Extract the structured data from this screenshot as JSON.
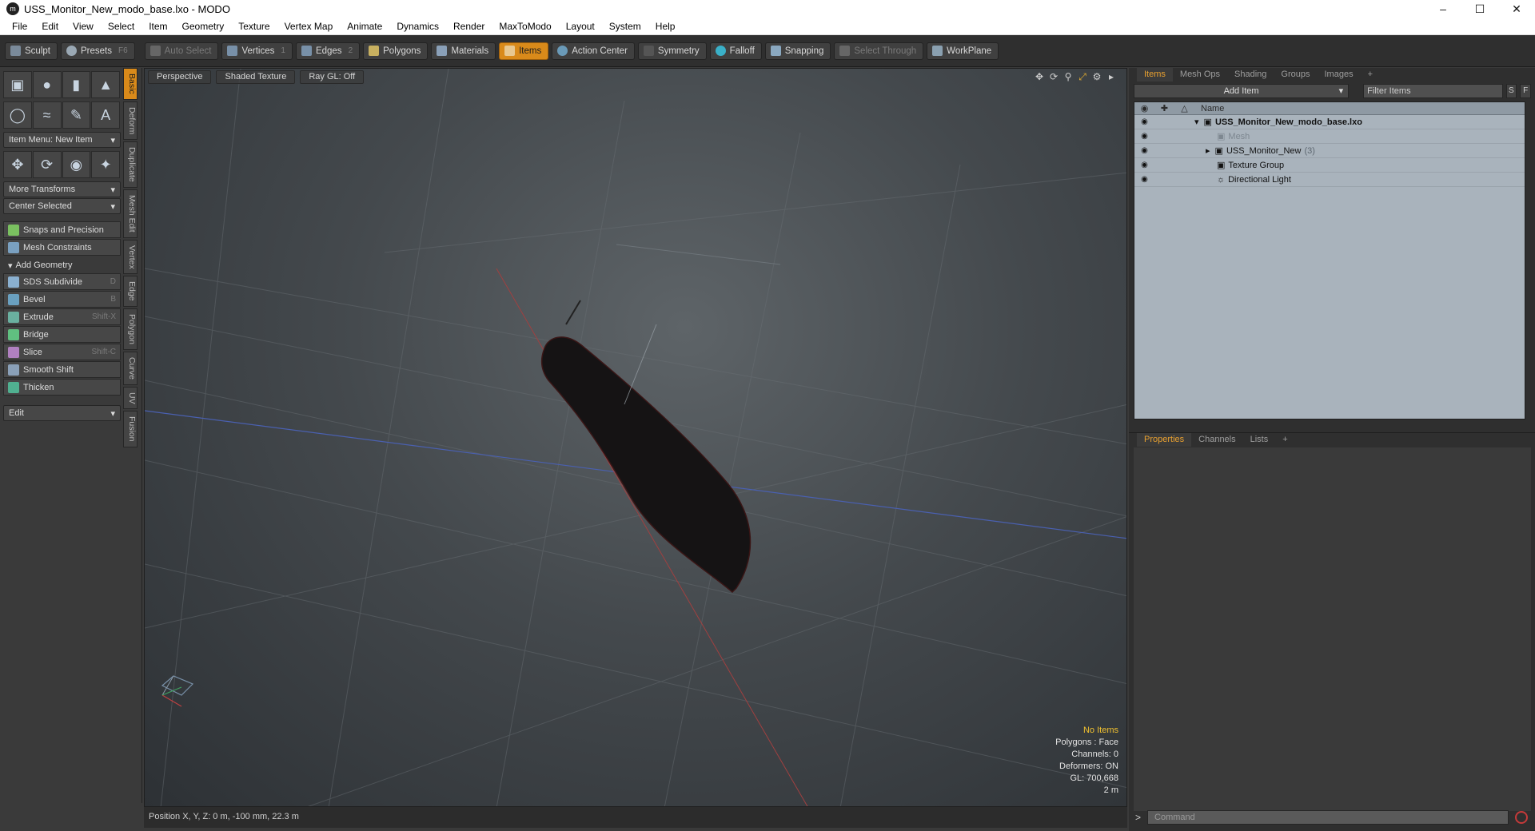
{
  "window": {
    "title": "USS_Monitor_New_modo_base.lxo - MODO",
    "app_icon": "modo-logo-icon"
  },
  "menu": [
    "File",
    "Edit",
    "View",
    "Select",
    "Item",
    "Geometry",
    "Texture",
    "Vertex Map",
    "Animate",
    "Dynamics",
    "Render",
    "MaxToModo",
    "Layout",
    "System",
    "Help"
  ],
  "toolbar": {
    "sculpt": "Sculpt",
    "presets": "Presets",
    "presets_key": "F6",
    "auto_select": "Auto Select",
    "vertices": "Vertices",
    "vertices_key": "1",
    "edges": "Edges",
    "edges_key": "2",
    "polygons": "Polygons",
    "materials": "Materials",
    "items": "Items",
    "action_center": "Action Center",
    "symmetry": "Symmetry",
    "falloff": "Falloff",
    "snapping": "Snapping",
    "select_through": "Select Through",
    "workplane": "WorkPlane"
  },
  "left_panel": {
    "item_menu": "Item Menu: New Item",
    "more_transforms": "More Transforms",
    "center_selected": "Center Selected",
    "snaps": "Snaps and Precision",
    "mesh_constraints": "Mesh Constraints",
    "add_geometry": "Add Geometry",
    "tools": [
      {
        "label": "SDS Subdivide",
        "key": "D"
      },
      {
        "label": "Bevel",
        "key": "B"
      },
      {
        "label": "Extrude",
        "key": "Shift-X"
      },
      {
        "label": "Bridge",
        "key": ""
      },
      {
        "label": "Slice",
        "key": "Shift-C"
      },
      {
        "label": "Smooth Shift",
        "key": ""
      },
      {
        "label": "Thicken",
        "key": ""
      }
    ],
    "edit": "Edit",
    "vtabs": [
      "Basic",
      "Deform",
      "Duplicate",
      "Mesh Edit",
      "Vertex",
      "Edge",
      "Polygon",
      "Curve",
      "UV",
      "Fusion"
    ]
  },
  "viewport": {
    "perspective": "Perspective",
    "shading": "Shaded Texture",
    "raygl": "Ray GL: Off",
    "info": {
      "no_items": "No Items",
      "polygons": "Polygons : Face",
      "channels": "Channels: 0",
      "deformers": "Deformers: ON",
      "gl": "GL: 700,668",
      "scale": "2 m"
    }
  },
  "status": {
    "position": "Position X, Y, Z:  0 m, -100 mm, 22.3 m"
  },
  "items_panel": {
    "tabs": [
      "Items",
      "Mesh Ops",
      "Shading",
      "Groups",
      "Images"
    ],
    "add_item": "Add Item",
    "filter": "Filter Items",
    "s_btn": "S",
    "f_btn": "F",
    "column_name": "Name",
    "rows": [
      {
        "name": "USS_Monitor_New_modo_base.lxo",
        "count": ""
      },
      {
        "name": "Mesh",
        "count": ""
      },
      {
        "name": "USS_Monitor_New",
        "count": "(3)"
      },
      {
        "name": "Texture Group",
        "count": ""
      },
      {
        "name": "Directional Light",
        "count": ""
      }
    ]
  },
  "properties_panel": {
    "tabs": [
      "Properties",
      "Channels",
      "Lists"
    ],
    "command_placeholder": "Command"
  },
  "colors": {
    "accent": "#d98a1a",
    "warning": "#f0c030"
  }
}
